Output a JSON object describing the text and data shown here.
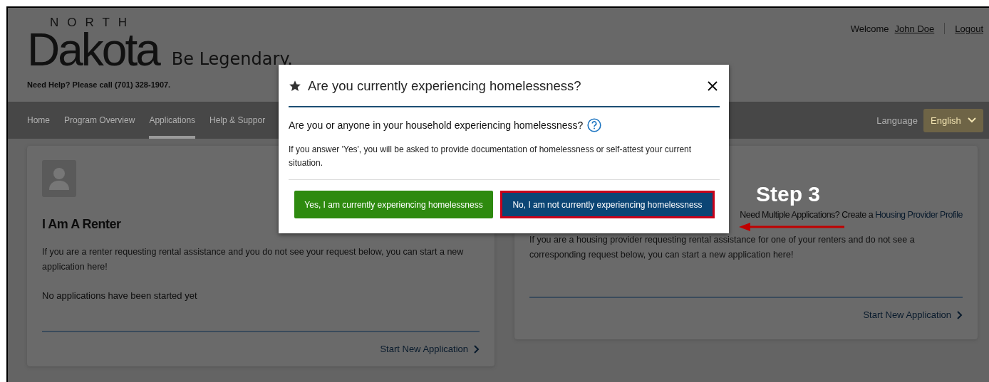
{
  "header": {
    "logo_top": "NORTH",
    "logo": "Dakota",
    "tagline": "Be Legendary.",
    "help": "Need Help? Please call (701) 328-1907.",
    "welcome": "Welcome",
    "user": "John Doe",
    "logout": "Logout"
  },
  "nav": {
    "items": [
      {
        "label": "Home",
        "selected": false
      },
      {
        "label": "Program Overview",
        "selected": false
      },
      {
        "label": "Applications",
        "selected": true
      },
      {
        "label": "Help & Suppor",
        "selected": false
      }
    ],
    "language_label": "Language",
    "language": "English"
  },
  "renter_card": {
    "title": "I Am A Renter",
    "description": "If you are a renter requesting rental assistance and you do not see your request below, you can start a new application here!",
    "empty_message": "No applications have been started yet",
    "link": "Start New Application"
  },
  "provider_card": {
    "prompt": "Need Multiple Applications? Create a",
    "prompt_link": "Housing Provider Profile",
    "description": "If you are a housing provider requesting rental assistance for one of your renters and do not see a corresponding request below, you can start a new application here!",
    "link": "Start New Application"
  },
  "dialog": {
    "title": "Are you currently experiencing homelessness?",
    "question": "Are you or anyone in your household experiencing homelessness?",
    "note": "If you answer 'Yes', you will be asked to provide documentation of homelessness or self-attest your current situation.",
    "buttons": [
      {
        "label": "Yes, I am currently experiencing homelessness",
        "kind": "confirm",
        "highlighted": false
      },
      {
        "label": "No, I am not currently experiencing homelessness",
        "kind": "decline",
        "highlighted": true
      }
    ]
  },
  "annotation": {
    "label": "Step 3"
  }
}
